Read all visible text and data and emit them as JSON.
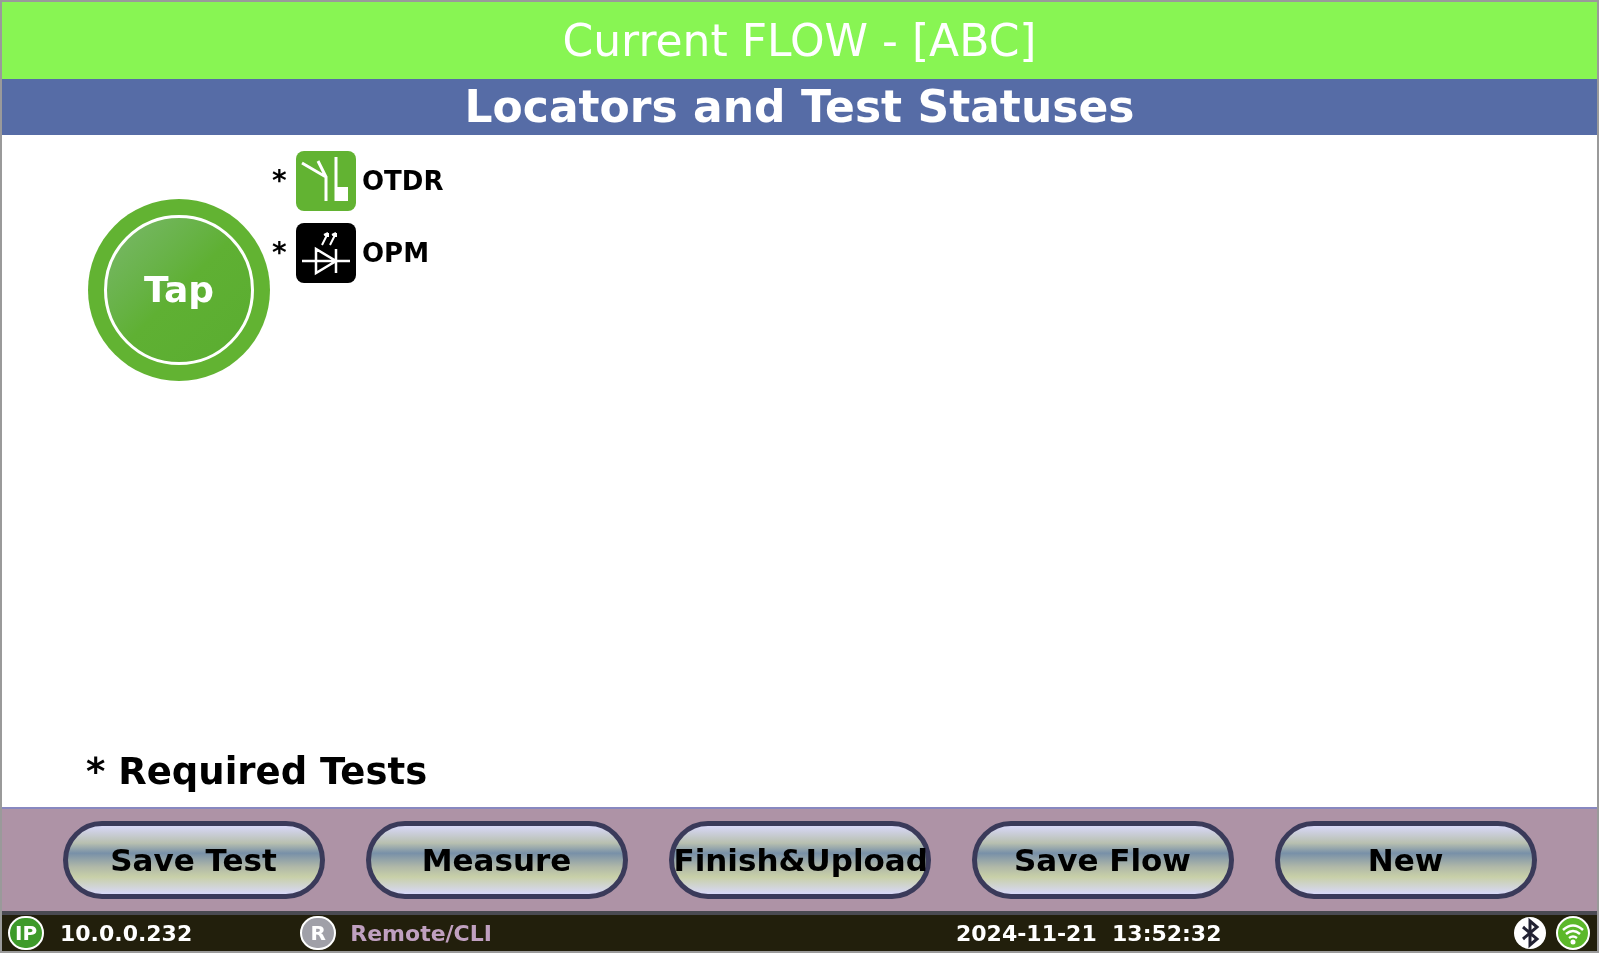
{
  "header": {
    "title": "Current FLOW - [ABC]",
    "subtitle": "Locators and Test Statuses"
  },
  "locator": {
    "label": "Tap"
  },
  "tests": [
    {
      "kind": "otdr",
      "label": "OTDR",
      "required": true,
      "mark": "*"
    },
    {
      "kind": "opm",
      "label": "OPM",
      "required": true,
      "mark": "*"
    }
  ],
  "legend": "* Required Tests",
  "buttons": [
    "Save Test",
    "Measure",
    "Finish&Upload",
    "Save Flow",
    "New"
  ],
  "status_bar": {
    "ip_badge": "IP",
    "ip": "10.0.0.232",
    "remote_badge": "R",
    "remote": "Remote/CLI",
    "datetime": "2024-11-21  13:52:32"
  }
}
